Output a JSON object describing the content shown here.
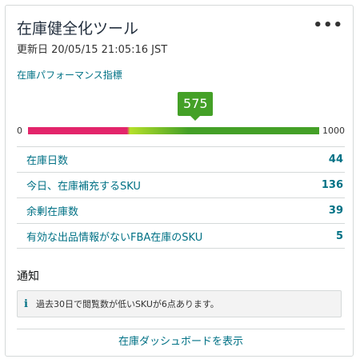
{
  "card": {
    "title": "在庫健全化ツール",
    "more_menu": "•••",
    "updated": "更新日 20/05/15 21:05:16 JST",
    "metric_link": "在庫パフォーマンス指標"
  },
  "gauge": {
    "min_label": "0",
    "max_label": "1000",
    "value": 575,
    "value_label": "575",
    "min": 0,
    "max": 1000,
    "colors": {
      "low": "#e3256b",
      "mid": "#b5e02a",
      "high": "#44a027"
    }
  },
  "rows": [
    {
      "label": "在庫日数",
      "value": "44"
    },
    {
      "label": "今日、在庫補充するSKU",
      "value": "136"
    },
    {
      "label": "余剰在庫数",
      "value": "39"
    },
    {
      "label": "有効な出品情報がないFBA在庫のSKU",
      "value": "5"
    }
  ],
  "notice": {
    "title": "通知",
    "icon": "info-icon",
    "text": "過去30日で閲覧数が低いSKUが6点あります。"
  },
  "footer": {
    "link": "在庫ダッシュボードを表示"
  }
}
